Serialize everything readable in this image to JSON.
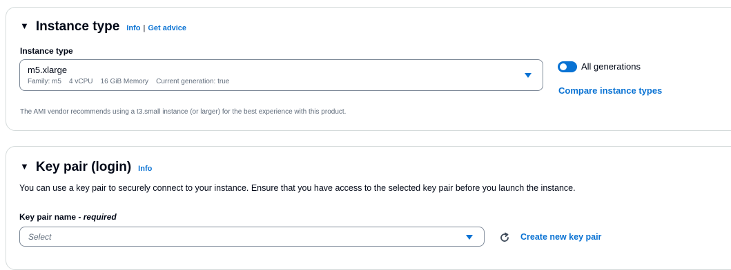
{
  "instance_type_section": {
    "title": "Instance type",
    "info_link": "Info",
    "separator": "|",
    "advice_link": "Get advice",
    "field_label": "Instance type",
    "selected_value": "m5.xlarge",
    "selected_description": "Family: m5    4 vCPU    16 GiB Memory    Current generation: true",
    "toggle_label": "All generations",
    "toggle_on": true,
    "compare_link": "Compare instance types",
    "note": "The AMI vendor recommends using a t3.small instance (or larger) for the best experience with this product."
  },
  "key_pair_section": {
    "title": "Key pair (login)",
    "info_link": "Info",
    "description": "You can use a key pair to securely connect to your instance. Ensure that you have access to the selected key pair before you launch the instance.",
    "field_label": "Key pair name",
    "field_label_suffix": "- required",
    "placeholder": "Select",
    "create_link": "Create new key pair"
  },
  "icons": {
    "collapse": "caret-down-filled-icon",
    "dropdown": "caret-down-icon",
    "refresh": "refresh-icon"
  },
  "colors": {
    "link": "#0972d3",
    "text": "#000716",
    "secondary_text": "#5f6b7a",
    "border": "#d5dbdb",
    "input_border": "#7d8998"
  }
}
